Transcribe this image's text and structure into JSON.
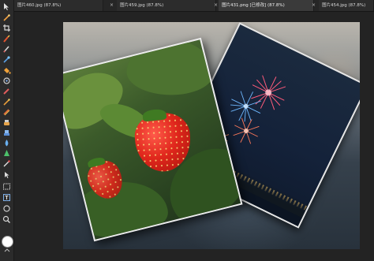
{
  "tabs": [
    {
      "label": "图片460.jpg (87.8%)",
      "active": false
    },
    {
      "label": "图片459.jpg (87.8%)",
      "active": false
    },
    {
      "label": "图片431.png [已修改] (87.8%)",
      "active": true
    },
    {
      "label": "图片454.jpg (87.8%)",
      "active": false
    }
  ],
  "close_glyph": "×",
  "tools": [
    {
      "name": "move-tool-icon"
    },
    {
      "name": "brush-tool-icon"
    },
    {
      "name": "crop-tool-icon"
    },
    {
      "name": "paint-tool-icon"
    },
    {
      "name": "pencil-tool-icon"
    },
    {
      "name": "color-picker-icon"
    },
    {
      "name": "fill-tool-icon"
    },
    {
      "name": "clone-tool-icon"
    },
    {
      "name": "eraser-tool-icon"
    },
    {
      "name": "retouch-tool-icon"
    },
    {
      "name": "healing-tool-icon"
    },
    {
      "name": "smudge-tool-icon"
    },
    {
      "name": "dodge-tool-icon"
    },
    {
      "name": "blur-tool-icon"
    },
    {
      "name": "sharpen-tool-icon"
    },
    {
      "name": "selection-tool-icon"
    },
    {
      "name": "vector-tool-icon"
    },
    {
      "name": "marquee-tool-icon"
    },
    {
      "name": "text-tool-icon"
    },
    {
      "name": "shape-tool-icon"
    },
    {
      "name": "zoom-tool-icon"
    }
  ],
  "colors": {
    "foreground": "#ffffff",
    "tab_active": "#3a3a3a",
    "tab_inactive": "#2c2c2c"
  }
}
